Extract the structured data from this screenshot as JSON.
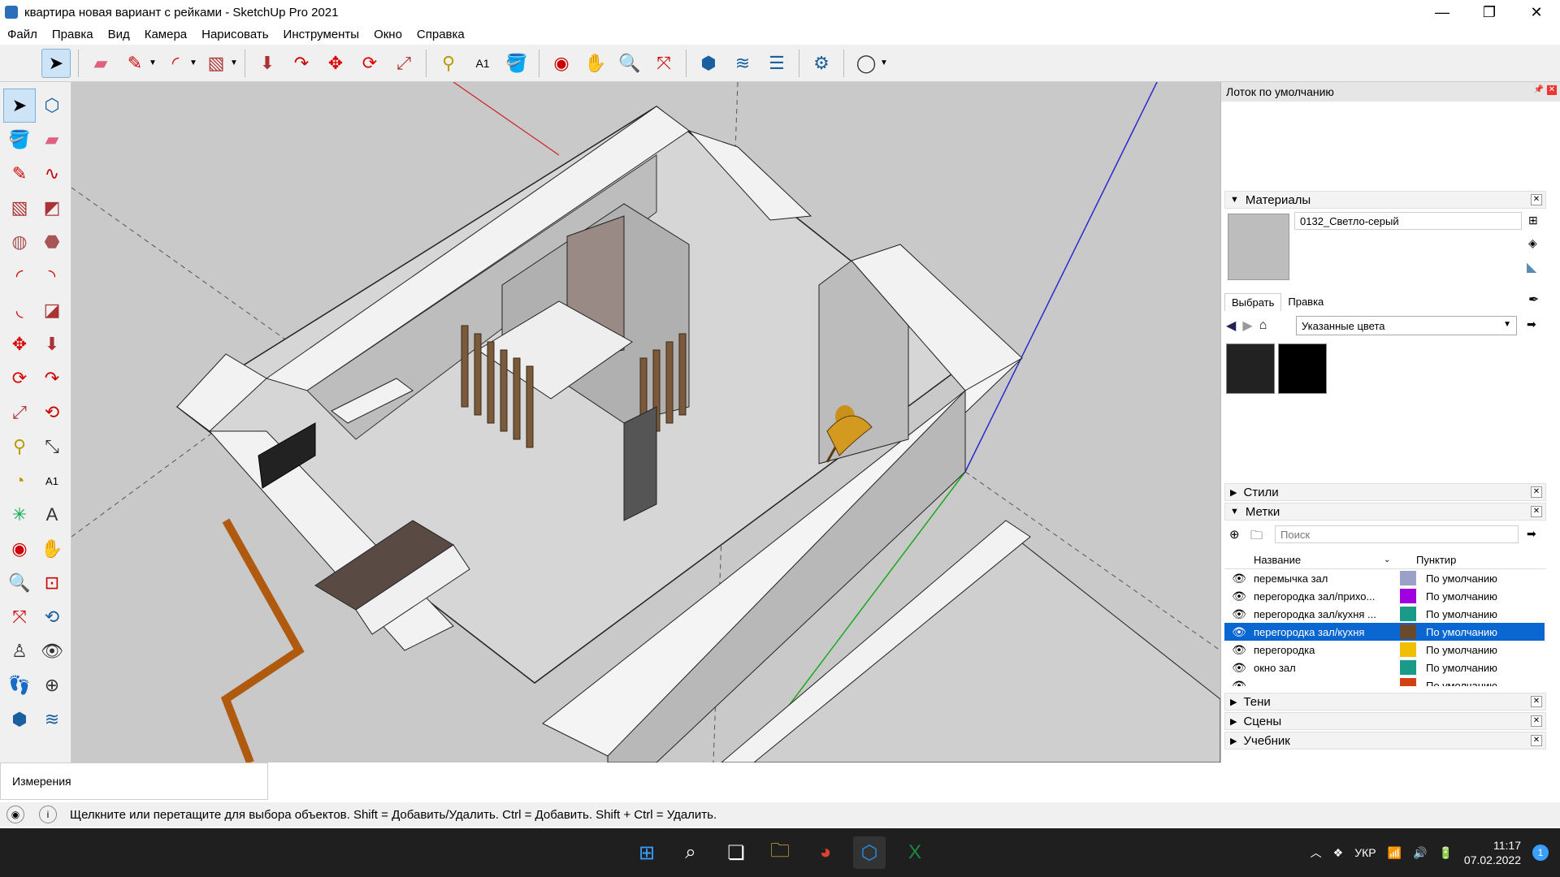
{
  "window": {
    "title": "квартира новая вариант с рейками - SketchUp Pro 2021"
  },
  "menu": [
    "Файл",
    "Правка",
    "Вид",
    "Камера",
    "Нарисовать",
    "Инструменты",
    "Окно",
    "Справка"
  ],
  "toolbar": {
    "icons": [
      "select-icon",
      "eraser-icon",
      "pencil-icon",
      "arc-icon",
      "rectangle-icon",
      "push-pull-icon",
      "follow-me-icon",
      "move-icon",
      "rotate-icon",
      "scale-icon",
      "tape-measure-icon",
      "text-icon",
      "paint-bucket-icon",
      "orbit-icon",
      "pan-icon",
      "zoom-icon",
      "zoom-extents-icon",
      "warehouse-icon",
      "extension-warehouse-icon",
      "layout-icon",
      "extension-manager-icon",
      "account-icon"
    ]
  },
  "tray": {
    "title": "Лоток по умолчанию",
    "materials": {
      "header": "Материалы",
      "current_name": "0132_Светло-серый",
      "tab_select": "Выбрать",
      "tab_edit": "Правка",
      "collection": "Указанные цвета",
      "swatch_color": "#bdbdbd",
      "swatches": [
        "#222222",
        "#000000"
      ]
    },
    "styles_header": "Стили",
    "tags": {
      "header": "Метки",
      "search_placeholder": "Поиск",
      "col_name": "Название",
      "col_dash": "Пунктир",
      "rows": [
        {
          "name": "перемычка зал",
          "color": "#9aa0c8",
          "dash": "По умолчанию"
        },
        {
          "name": "перегородка зал/прихо...",
          "color": "#a000e0",
          "dash": "По умолчанию"
        },
        {
          "name": "перегородка зал/кухня ...",
          "color": "#1a9a88",
          "dash": "По умолчанию"
        },
        {
          "name": "перегородка зал/кухня",
          "color": "#6a4a2a",
          "dash": "По умолчанию",
          "selected": true
        },
        {
          "name": "перегородка",
          "color": "#f0c000",
          "dash": "По умолчанию"
        },
        {
          "name": "окно зал",
          "color": "#1a9a88",
          "dash": "По умолчанию"
        },
        {
          "name": "",
          "color": "#d04010",
          "dash": "По умолчанию"
        }
      ]
    },
    "shadows_header": "Тени",
    "scenes_header": "Сцены",
    "tutorial_header": "Учебник"
  },
  "measurements": {
    "label": "Измерения"
  },
  "status": {
    "hint": "Щелкните или перетащите для выбора объектов. Shift = Добавить/Удалить. Ctrl = Добавить. Shift + Ctrl = Удалить."
  },
  "taskbar": {
    "lang": "УКР",
    "time": "11:17",
    "date": "07.02.2022",
    "notif": "1"
  }
}
